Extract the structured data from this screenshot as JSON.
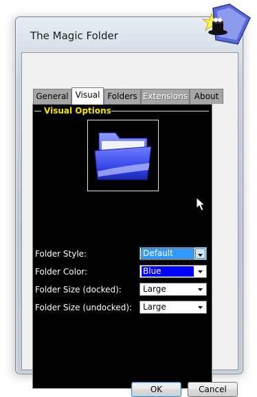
{
  "window": {
    "title": "The Magic Folder"
  },
  "tabs": [
    {
      "label": "General"
    },
    {
      "label": "Visual"
    },
    {
      "label": "Folders"
    },
    {
      "label": "Extensions"
    },
    {
      "label": "About"
    }
  ],
  "section": {
    "title": "Visual Options"
  },
  "fields": [
    {
      "label": "Folder Style:",
      "value": "Default"
    },
    {
      "label": "Folder Color:",
      "value": "Blue"
    },
    {
      "label": "Folder Size (docked):",
      "value": "Large"
    },
    {
      "label": "Folder Size (undocked):",
      "value": "Large"
    }
  ],
  "buttons": {
    "ok": "OK",
    "cancel": "Cancel"
  },
  "icons": {
    "logo": "magic-hat-folder-icon",
    "preview": "blue-folder-icon",
    "dropdown": "dropdown-arrow-icon",
    "cursor": "mouse-pointer-icon"
  },
  "colors": {
    "panel_bg": "#000000",
    "section_title": "#f5e400",
    "selected_color": "#0000ff",
    "highlight": "#3399ff"
  }
}
